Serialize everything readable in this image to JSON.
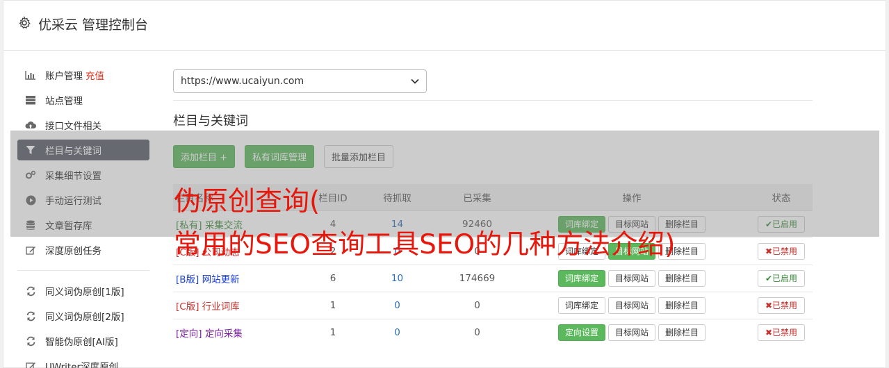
{
  "app": {
    "title": "优采云 管理控制台"
  },
  "sidebar": {
    "items": [
      {
        "label": "账户管理",
        "extra": "充值",
        "icon": "bar-chart-icon"
      },
      {
        "label": "站点管理",
        "icon": "server-icon"
      },
      {
        "label": "接口文件相关",
        "icon": "cloud-upload-icon"
      },
      {
        "label": "栏目与关键词",
        "icon": "filter-icon",
        "active": true
      },
      {
        "label": "采集细节设置",
        "icon": "cogs-icon"
      },
      {
        "label": "手动运行测试",
        "icon": "play-icon"
      },
      {
        "label": "文章暂存库",
        "icon": "database-icon"
      },
      {
        "label": "深度原创任务",
        "icon": "edit-icon"
      }
    ],
    "items2": [
      {
        "label": "同义词伪原创[1版]",
        "icon": "refresh-icon"
      },
      {
        "label": "同义词伪原创[2版]",
        "icon": "refresh-icon"
      },
      {
        "label": "智能伪原创[AI版]",
        "icon": "refresh-icon"
      },
      {
        "label": "UWriter深度原创",
        "icon": "edit-icon"
      }
    ]
  },
  "site_select": {
    "value": "https://www.ucaiyun.com"
  },
  "section": {
    "title": "栏目与关键词"
  },
  "toolbar": {
    "add_column": "添加栏目 +",
    "private_lib": "私有词库管理",
    "batch_add": "批量添加栏目"
  },
  "table": {
    "headers": [
      "栏目名称",
      "栏目ID",
      "待抓取",
      "已采集",
      "操作",
      "状态"
    ],
    "rows": [
      {
        "tag": "[私有]",
        "name": "采集交流",
        "id": "4",
        "pending": "14",
        "collected": "92460",
        "op1": "词库绑定",
        "op1_green": true,
        "op2": "目标网站",
        "op3": "删除栏目",
        "status": "✔已启用",
        "on": true
      },
      {
        "tag": "[C版]",
        "name": "公司动态",
        "id": "2",
        "pending": "0",
        "collected": "0",
        "op1": "词库绑定",
        "op1_green": false,
        "op2": "目标网站",
        "op3": "删除栏目",
        "status": "✖已禁用",
        "on": false
      },
      {
        "tag": "[B版]",
        "name": "网站更新",
        "id": "6",
        "pending": "10",
        "collected": "174669",
        "op1": "词库绑定",
        "op1_green": true,
        "op2": "目标网站",
        "op3": "删除栏目",
        "status": "✔已启用",
        "on": true
      },
      {
        "tag": "[C版]",
        "name": "行业词库",
        "id": "1",
        "pending": "0",
        "collected": "0",
        "op1": "词库绑定",
        "op1_green": false,
        "op2": "目标网站",
        "op3": "删除栏目",
        "status": "✖已禁用",
        "on": false
      },
      {
        "tag": "[定向]",
        "name": "定向采集",
        "id": "1",
        "pending": "0",
        "collected": "0",
        "op1": "定向设置",
        "op1_green": true,
        "op2": "目标网站",
        "op3": "删除栏目",
        "status": "✖已禁用",
        "on": false
      }
    ]
  },
  "watermark": {
    "line1": "伪原创查询(",
    "line2": "常用的SEO查询工具SEO的几种方法介绍)"
  }
}
